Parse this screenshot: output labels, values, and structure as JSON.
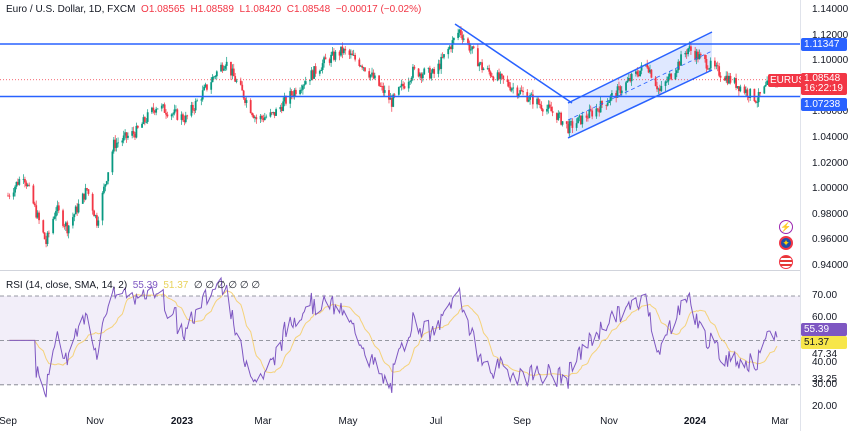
{
  "legend": {
    "symbol": "Euro / U.S. Dollar, 1D, FXCM",
    "open": "O1.08565",
    "high": "H1.08589",
    "low": "L1.08420",
    "close": "C1.08548",
    "change": "−0.00017 (−0.02%)"
  },
  "rsi_legend": {
    "label": "RSI (14, close, SMA, 14, 2)",
    "rsi": "55.39",
    "sma": "51.37",
    "extras": "∅ ∅ ∅ ∅ ∅ ∅"
  },
  "price_axis": [
    "1.14000",
    "1.12000",
    "1.10000",
    "1.06000",
    "1.04000",
    "1.02000",
    "1.00000",
    "0.98000",
    "0.96000",
    "0.94000"
  ],
  "rsi_axis": [
    "70.00",
    "60.00",
    "40.00",
    "30.00",
    "20.00"
  ],
  "tags": {
    "resistance": "1.11347",
    "support": "1.07238",
    "symbol": "EURUSD",
    "last": "1.08548",
    "countdown": "16:22:19",
    "rsi": "55.39",
    "rsi_sma": "51.37",
    "rsi_hi": "47.34",
    "rsi_lo": "33.25"
  },
  "date_axis": [
    "Sep",
    "Nov",
    "2023",
    "Mar",
    "May",
    "Jul",
    "Sep",
    "Nov",
    "2024",
    "Mar"
  ],
  "colors": {
    "up": "#089981",
    "down": "#f23645",
    "line": "#2962ff",
    "rsi": "#7e57c2",
    "sma": "#f5d27a"
  },
  "chart_data": {
    "type": "candlestick",
    "title": "Euro / U.S. Dollar, 1D, FXCM",
    "ylim": [
      0.94,
      1.14
    ],
    "price_path": [
      [
        "2022-09-01",
        0.995
      ],
      [
        "2022-09-12",
        1.012
      ],
      [
        "2022-09-28",
        0.958
      ],
      [
        "2022-10-05",
        0.985
      ],
      [
        "2022-10-13",
        0.97
      ],
      [
        "2022-10-27",
        1.0
      ],
      [
        "2022-11-03",
        0.975
      ],
      [
        "2022-11-15",
        1.035
      ],
      [
        "2022-12-01",
        1.045
      ],
      [
        "2022-12-15",
        1.065
      ],
      [
        "2023-01-05",
        1.055
      ],
      [
        "2023-01-26",
        1.09
      ],
      [
        "2023-02-02",
        1.1
      ],
      [
        "2023-02-24",
        1.055
      ],
      [
        "2023-03-08",
        1.058
      ],
      [
        "2023-03-24",
        1.078
      ],
      [
        "2023-04-14",
        1.1
      ],
      [
        "2023-04-26",
        1.108
      ],
      [
        "2023-05-10",
        1.098
      ],
      [
        "2023-05-31",
        1.068
      ],
      [
        "2023-06-15",
        1.092
      ],
      [
        "2023-06-30",
        1.09
      ],
      [
        "2023-07-18",
        1.124
      ],
      [
        "2023-08-03",
        1.095
      ],
      [
        "2023-08-24",
        1.08
      ],
      [
        "2023-09-05",
        1.072
      ],
      [
        "2023-09-25",
        1.058
      ],
      [
        "2023-10-03",
        1.048
      ],
      [
        "2023-10-20",
        1.06
      ],
      [
        "2023-11-06",
        1.075
      ],
      [
        "2023-11-28",
        1.098
      ],
      [
        "2023-12-07",
        1.076
      ],
      [
        "2023-12-27",
        1.11
      ],
      [
        "2024-01-12",
        1.096
      ],
      [
        "2024-02-02",
        1.08
      ],
      [
        "2024-02-14",
        1.07
      ],
      [
        "2024-02-22",
        1.082
      ],
      [
        "2024-02-28",
        1.085
      ]
    ],
    "levels": [
      1.11347,
      1.07238
    ],
    "rsi": {
      "period": 14,
      "sma": 14,
      "current": 55.39,
      "sma_current": 51.37,
      "bands": [
        70,
        30
      ],
      "ylim": [
        20,
        80
      ]
    }
  }
}
